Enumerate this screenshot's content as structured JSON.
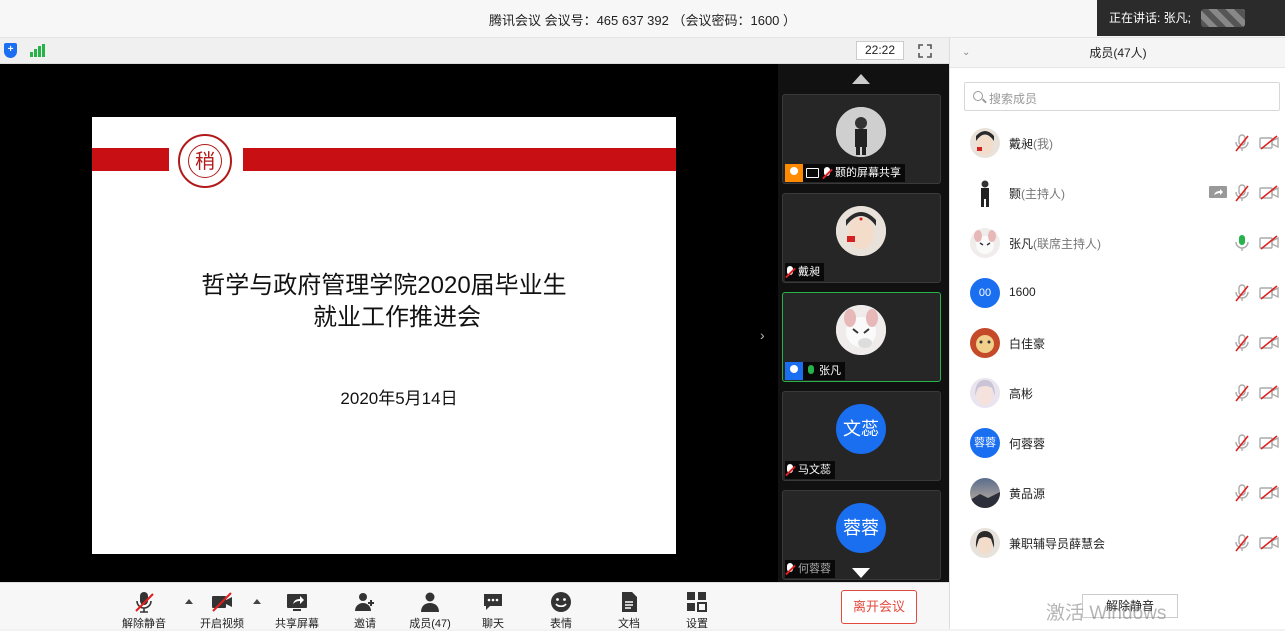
{
  "window": {
    "title": "腾讯会议 会议号：465 637 392 （会议密码：1600 ）"
  },
  "speaking": {
    "label": "正在讲话: 张凡;"
  },
  "meeting_bar": {
    "timer": "22:22"
  },
  "slide": {
    "title_line1": "哲学与政府管理学院2020届毕业生",
    "title_line2": "就业工作推进会",
    "date": "2020年5月14日",
    "seal_char": "稍"
  },
  "video_strip": {
    "tiles": [
      {
        "name": "颢的屏幕共享",
        "avatar": "photo",
        "mic": "muted",
        "badge": "host",
        "sharing": true
      },
      {
        "name": "戴昶",
        "avatar": "photo",
        "mic": "muted"
      },
      {
        "name": "张凡",
        "avatar": "photo",
        "mic": "active",
        "badge": "cohost",
        "active": true
      },
      {
        "name": "马文蕊",
        "avatar_text": "文蕊",
        "mic": "muted"
      },
      {
        "name": "何蓉蓉",
        "avatar_text": "蓉蓉",
        "mic": "muted"
      }
    ]
  },
  "toolbar": {
    "unmute": "解除静音",
    "video": "开启视频",
    "share": "共享屏幕",
    "invite": "邀请",
    "members": "成员(47)",
    "chat": "聊天",
    "reactions": "表情",
    "docs": "文档",
    "settings": "设置",
    "leave": "离开会议"
  },
  "panel": {
    "title": "成员(47人)",
    "search_placeholder": "搜索成员",
    "members": [
      {
        "name": "戴昶",
        "role": "(我)",
        "avatar": "photo",
        "mic": "muted",
        "cam": "off"
      },
      {
        "name": "颢",
        "role": "(主持人)",
        "avatar": "photo",
        "mic": "muted",
        "cam": "off",
        "sharing": true
      },
      {
        "name": "张凡",
        "role": "(联席主持人)",
        "avatar": "photo",
        "mic": "active",
        "cam": "off"
      },
      {
        "name": "1600",
        "role": "",
        "avatar_text": "00",
        "mic": "muted",
        "cam": "off"
      },
      {
        "name": "白佳豪",
        "role": "",
        "avatar": "photo",
        "mic": "muted",
        "cam": "off"
      },
      {
        "name": "高彬",
        "role": "",
        "avatar": "photo",
        "mic": "muted",
        "cam": "off"
      },
      {
        "name": "何蓉蓉",
        "role": "",
        "avatar_text": "蓉蓉",
        "mic": "muted",
        "cam": "off"
      },
      {
        "name": "黄品源",
        "role": "",
        "avatar": "photo",
        "mic": "muted",
        "cam": "off"
      },
      {
        "name": "兼职辅导员薛慧会",
        "role": "",
        "avatar": "photo",
        "mic": "muted",
        "cam": "off"
      }
    ],
    "unmute_all": "解除静音",
    "watermark": "激活 Windows"
  },
  "colors": {
    "accent": "#1a6ef0",
    "danger": "#e34a3e",
    "mic_active": "#27b34a",
    "slide_band": "#c81014"
  }
}
